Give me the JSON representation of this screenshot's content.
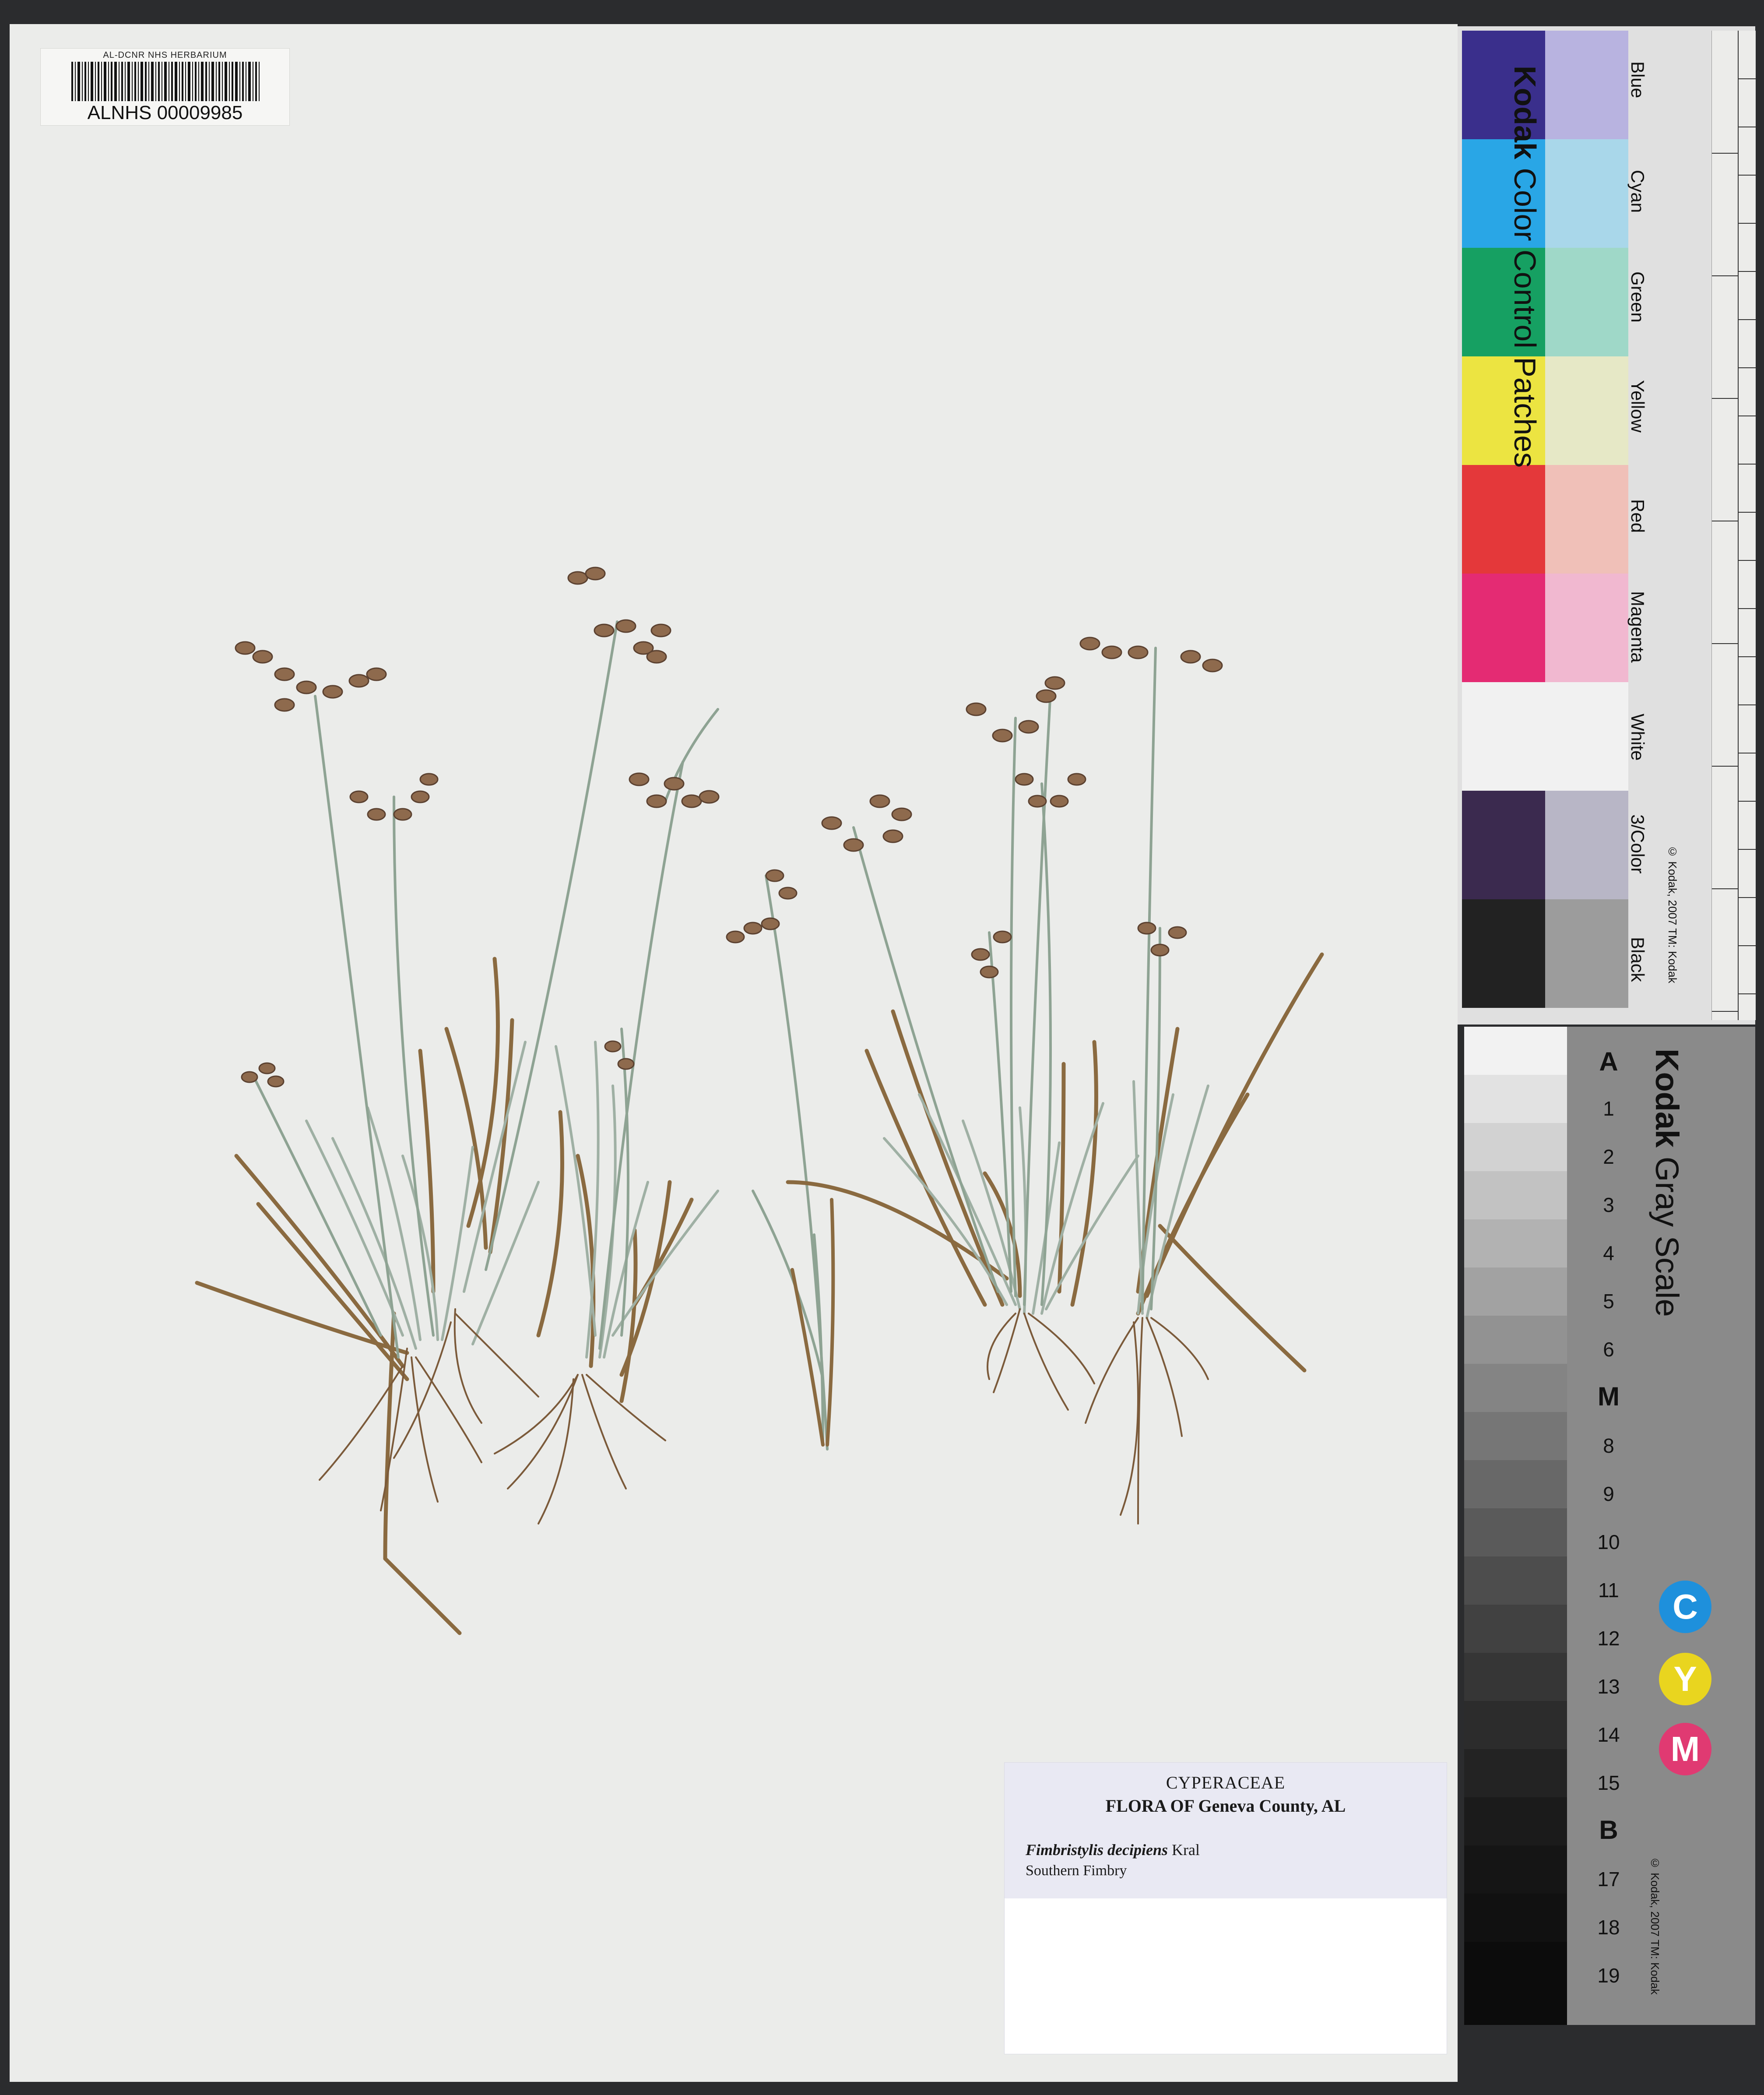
{
  "barcode": {
    "institution": "AL-DCNR NHS HERBARIUM",
    "catalog_number": "ALNHS 00009985"
  },
  "label": {
    "family": "CYPERACEAE",
    "flora": "FLORA OF Geneva County, AL",
    "species": "Fimbristylis decipiens",
    "author": "Kral",
    "common_name": "Southern Fimbry"
  },
  "color_card": {
    "title_brand": "Kodak",
    "title_rest": "Color Control Patches",
    "patches": [
      {
        "name": "Blue",
        "dark": "#3a2f8c",
        "light": "#b8b3e0"
      },
      {
        "name": "Cyan",
        "dark": "#29a6e6",
        "light": "#a9d7ea"
      },
      {
        "name": "Green",
        "dark": "#16a062",
        "light": "#9fd8c8"
      },
      {
        "name": "Yellow",
        "dark": "#ece441",
        "light": "#e6e8c6"
      },
      {
        "name": "Red",
        "dark": "#e4383a",
        "light": "#f0c0b8"
      },
      {
        "name": "Magenta",
        "dark": "#e42b73",
        "light": "#f1b8d0"
      },
      {
        "name": "White",
        "dark": "#f1f1f1",
        "light": "#f1f1f1"
      },
      {
        "name": "3/Color",
        "dark": "#3b2a4f",
        "light": "#b8b6c6"
      },
      {
        "name": "Black",
        "dark": "#222222",
        "light": "#9c9c9c"
      }
    ],
    "copyright": "© Kodak, 2007 TM: Kodak",
    "ruler_unit_cm": "cm",
    "ruler_unit_in": "inches"
  },
  "gray_card": {
    "title_brand": "Kodak",
    "title_rest": "Gray Scale",
    "steps": [
      "A",
      "1",
      "2",
      "3",
      "4",
      "5",
      "6",
      "M",
      "8",
      "9",
      "10",
      "11",
      "12",
      "13",
      "14",
      "15",
      "B",
      "17",
      "18",
      "19"
    ],
    "cym": [
      {
        "letter": "C",
        "color": "#1e90dc"
      },
      {
        "letter": "Y",
        "color": "#e9d51f"
      },
      {
        "letter": "M",
        "color": "#e03a72"
      }
    ],
    "copyright": "© Kodak, 2007 TM: Kodak"
  }
}
